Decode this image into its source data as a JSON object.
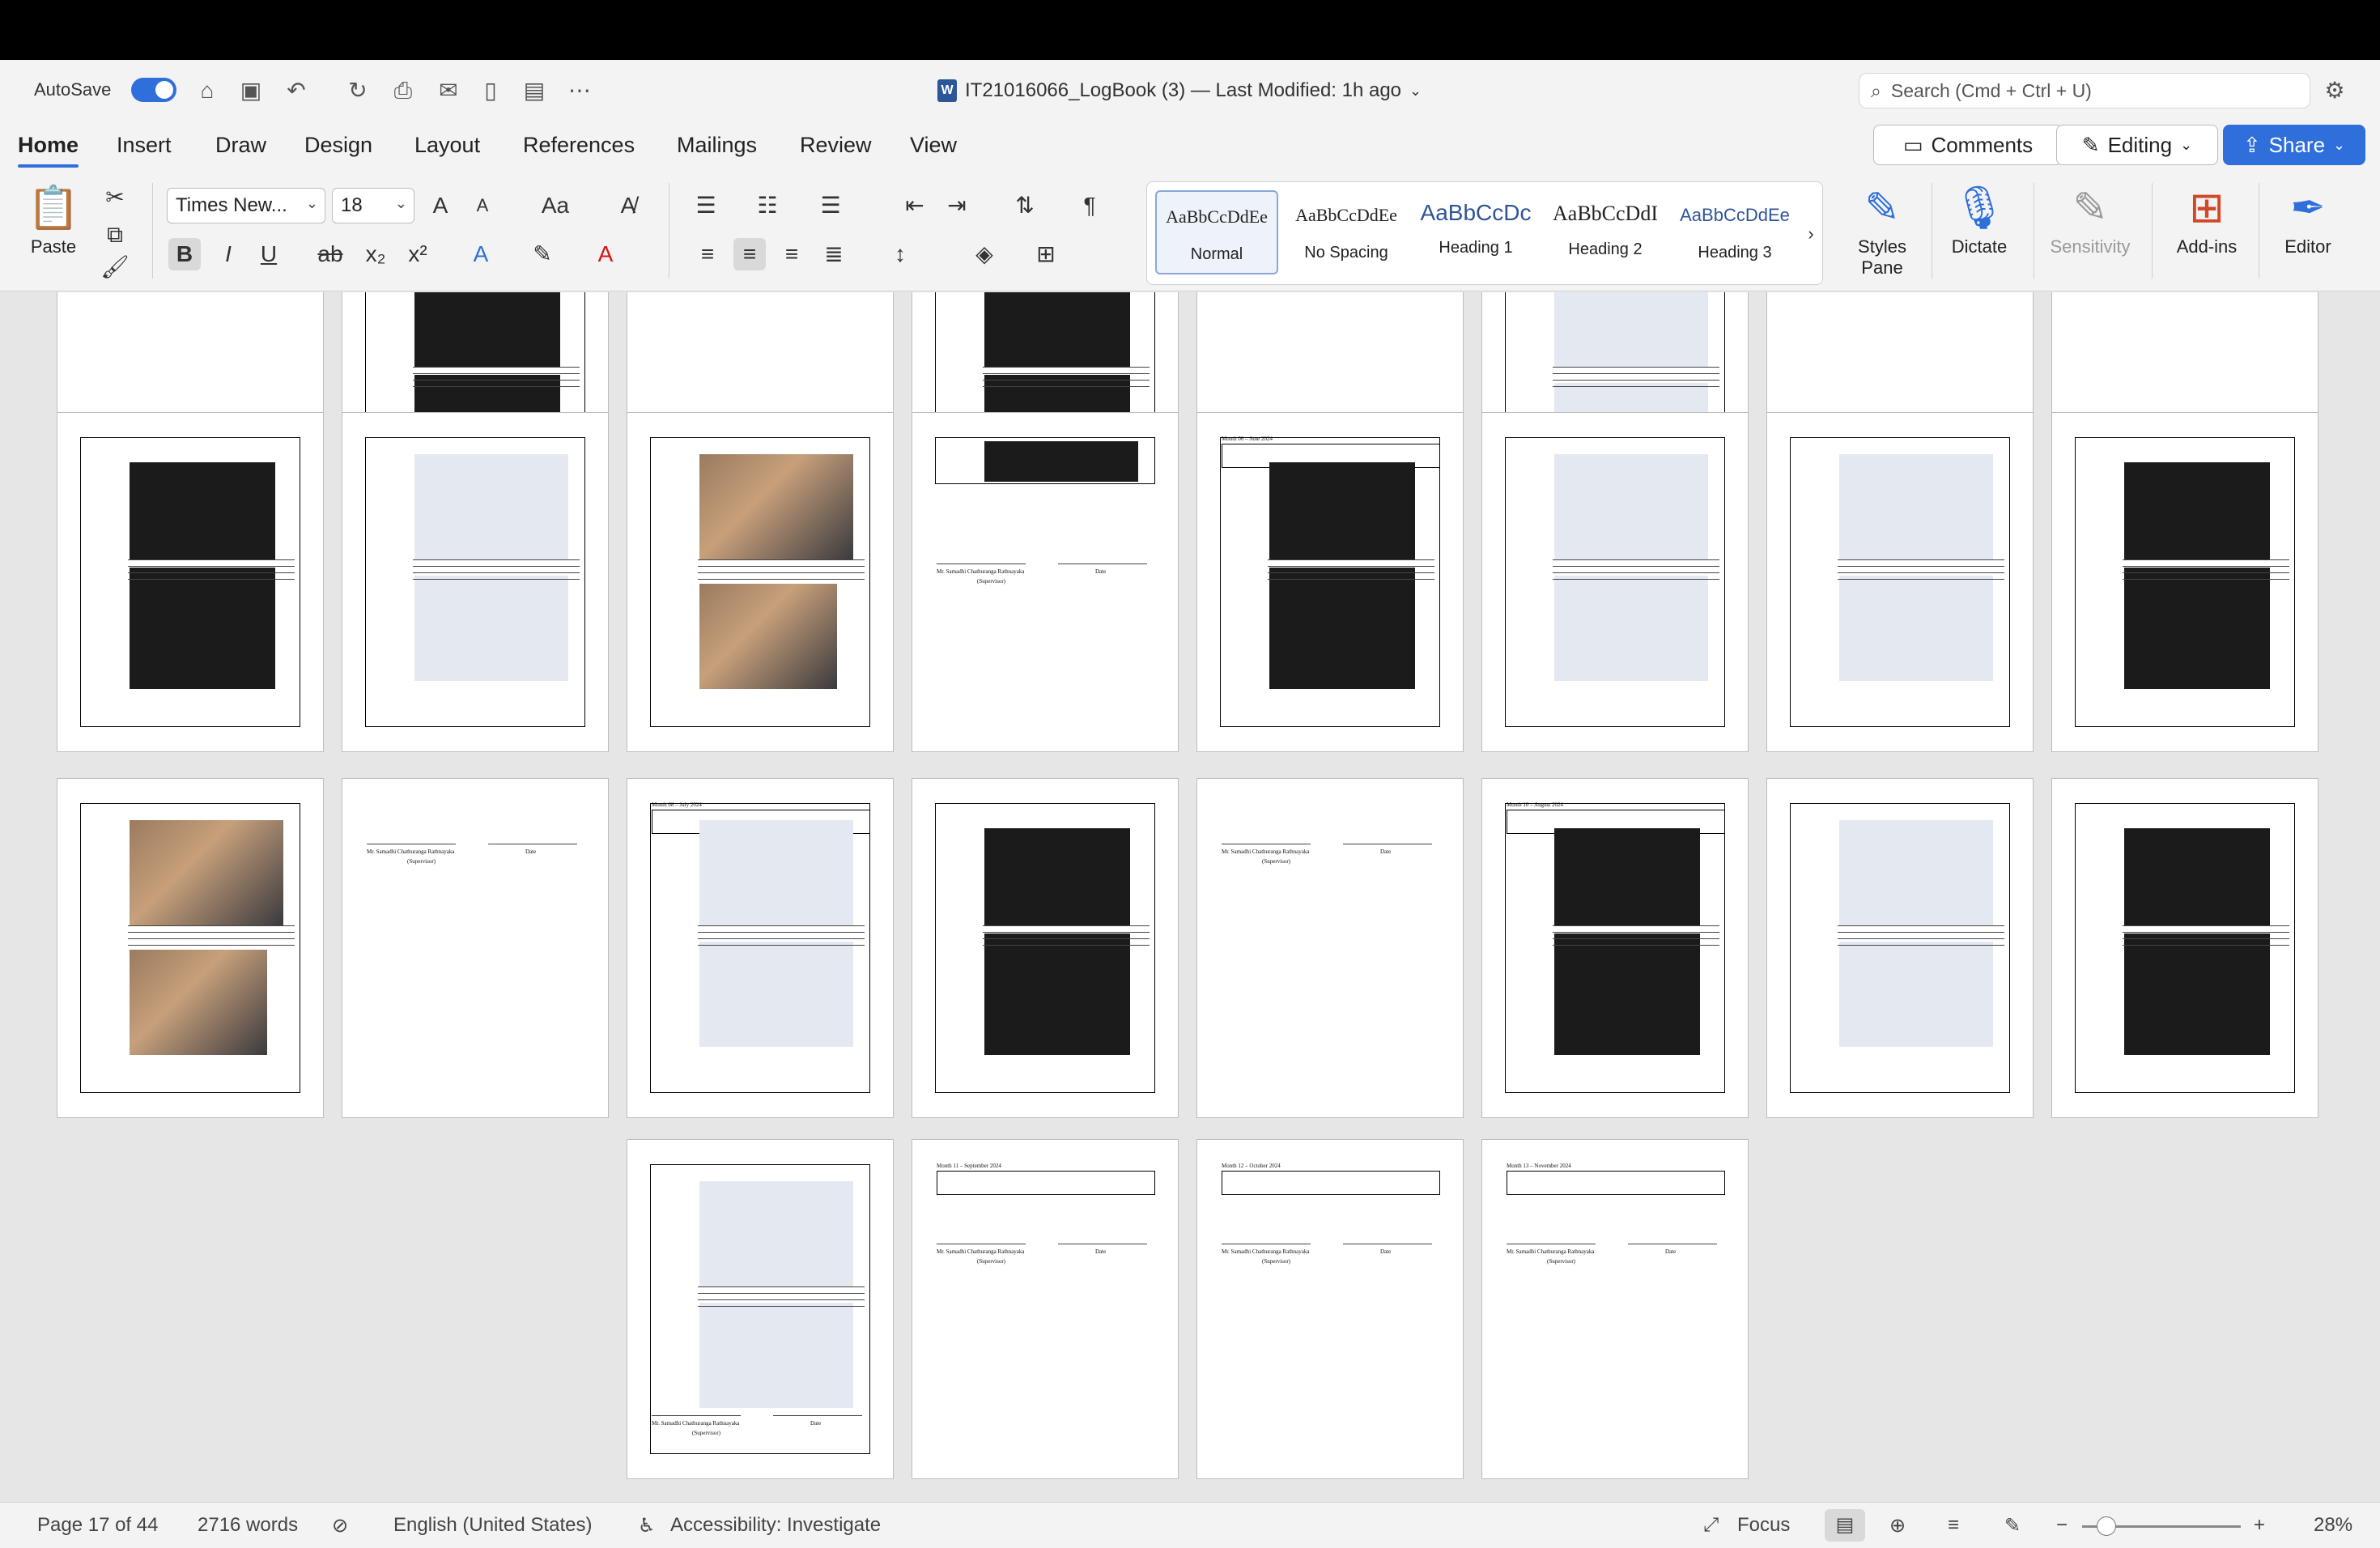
{
  "window": {
    "autosave_label": "AutoSave",
    "doc_title": "IT21016066_LogBook (3) — Last Modified: 1h ago",
    "search_placeholder": "Search (Cmd + Ctrl + U)"
  },
  "tabs": [
    "Home",
    "Insert",
    "Draw",
    "Design",
    "Layout",
    "References",
    "Mailings",
    "Review",
    "View"
  ],
  "actions": {
    "comments": "Comments",
    "editing": "Editing",
    "share": "Share"
  },
  "ribbon": {
    "paste": "Paste",
    "font_name": "Times New...",
    "font_size": "18",
    "styles": [
      {
        "sample": "AaBbCcDdEe",
        "label": "Normal"
      },
      {
        "sample": "AaBbCcDdEe",
        "label": "No Spacing"
      },
      {
        "sample": "AaBbCcDc",
        "label": "Heading 1"
      },
      {
        "sample": "AaBbCcDdI",
        "label": "Heading 2"
      },
      {
        "sample": "AaBbCcDdEe",
        "label": "Heading 3"
      }
    ],
    "styles_pane": "Styles Pane",
    "dictate": "Dictate",
    "sensitivity": "Sensitivity",
    "addins": "Add-ins",
    "editor": "Editor"
  },
  "pages_text": {
    "supervisor_name": "Mr. Samadhi Chathuranga Rathnayaka",
    "supervisor_role": "(Supervisor)",
    "date_label": "Date",
    "month_june": "Month 06 – June 2024",
    "month_july": "Month 08 – July 2024",
    "month_august": "Month 10 – August 2024",
    "month_september": "Month 11 – September 2024",
    "month_october": "Month 12 – October 2024",
    "month_november": "Month 13 – November 2024"
  },
  "status": {
    "page": "Page 17 of 44",
    "words": "2716 words",
    "language": "English (United States)",
    "accessibility": "Accessibility: Investigate",
    "focus": "Focus",
    "zoom": "28%"
  }
}
